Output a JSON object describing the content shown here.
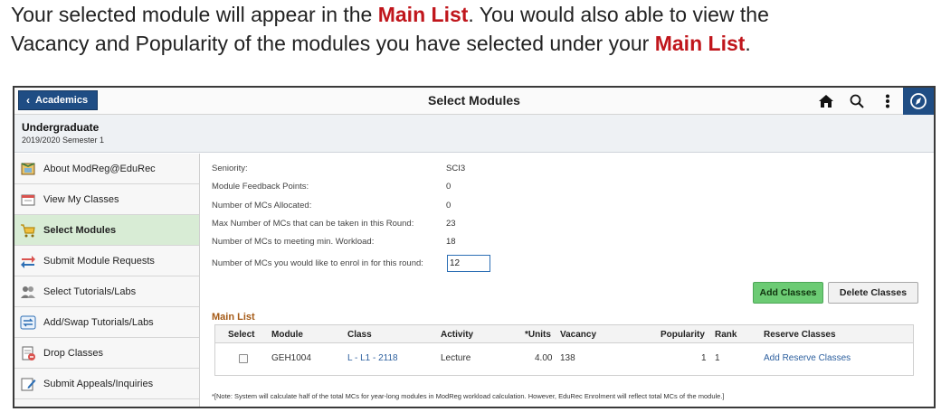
{
  "intro": {
    "line1_pre": "Your selected module will appear in the ",
    "line1_red": "Main List",
    "line1_post": ". You would also able to view the",
    "line2_pre": "Vacancy and Popularity of the modules you have selected under your ",
    "line2_red": "Main List",
    "line2_post": "."
  },
  "topbar": {
    "back_label": "Academics",
    "title": "Select Modules",
    "icons": [
      "home-icon",
      "search-icon",
      "more-icon",
      "navbar-icon"
    ]
  },
  "header": {
    "title": "Undergraduate",
    "term": "2019/2020 Semester 1"
  },
  "sidebar": {
    "items": [
      {
        "label": "About ModReg@EduRec",
        "icon": "info-book-icon",
        "active": false
      },
      {
        "label": "View My Classes",
        "icon": "calendar-icon",
        "active": false
      },
      {
        "label": "Select Modules",
        "icon": "cart-icon",
        "active": true
      },
      {
        "label": "Submit Module Requests",
        "icon": "exchange-icon",
        "active": false
      },
      {
        "label": "Select Tutorials/Labs",
        "icon": "group-icon",
        "active": false
      },
      {
        "label": "Add/Swap Tutorials/Labs",
        "icon": "swap-icon",
        "active": false
      },
      {
        "label": "Drop Classes",
        "icon": "drop-icon",
        "active": false
      },
      {
        "label": "Submit Appeals/Inquiries",
        "icon": "edit-icon",
        "active": false
      }
    ]
  },
  "info": {
    "seniority_label": "Seniority:",
    "seniority_value": "SCI3",
    "feedback_label": "Module Feedback Points:",
    "feedback_value": "0",
    "allocated_label": "Number of MCs Allocated:",
    "allocated_value": "0",
    "max_label": "Max Number of MCs that can be taken in this Round:",
    "max_value": "23",
    "min_workload_label": "Number of MCs to meeting min. Workload:",
    "min_workload_value": "18",
    "enrol_label": "Number of MCs you would like to enrol in for this round:",
    "enrol_value": "12"
  },
  "buttons": {
    "add": "Add Classes",
    "delete": "Delete Classes"
  },
  "main_list": {
    "title": "Main List",
    "columns": [
      "Select",
      "Module",
      "Class",
      "Activity",
      "*Units",
      "Vacancy",
      "Popularity",
      "Rank",
      "Reserve Classes"
    ],
    "rows": [
      {
        "module": "GEH1004",
        "class": "L - L1 - 2118",
        "activity": "Lecture",
        "units": "4.00",
        "vacancy": "138",
        "popularity": "1",
        "rank": "1",
        "reserve": "Add Reserve Classes",
        "selected": false
      }
    ]
  },
  "note": "*[Note: System will calculate half of the total MCs for year-long modules in ModReg workload calculation. However, EduRec Enrolment will reflect total MCs of the module.]",
  "colors": {
    "accent_red": "#c0161c",
    "nav_blue": "#1f4d84",
    "active_green": "#d8ecd5",
    "add_button_green": "#6ccb74",
    "main_list_title": "#a55a16",
    "link_blue": "#2c5f9e"
  }
}
